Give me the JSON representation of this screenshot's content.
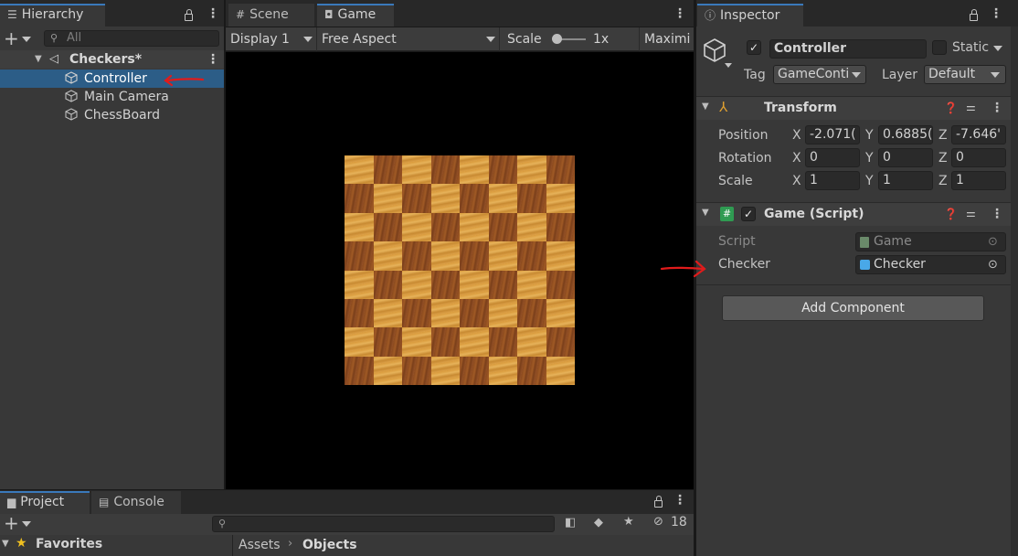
{
  "hierarchy": {
    "tab_label": "Hierarchy",
    "search_placeholder": "All",
    "scene_name": "Checkers*",
    "items": [
      {
        "label": "Controller"
      },
      {
        "label": "Main Camera"
      },
      {
        "label": "ChessBoard"
      }
    ]
  },
  "game_view": {
    "tabs": [
      {
        "label": "Scene",
        "icon": "grid-icon"
      },
      {
        "label": "Game",
        "icon": "gamepad-icon"
      }
    ],
    "display": "Display 1",
    "aspect": "Free Aspect",
    "scale_label": "Scale",
    "scale_value": "1x",
    "maximize_label": "Maximi",
    "board": {
      "rows": 8,
      "cols": 8
    }
  },
  "inspector": {
    "tab_label": "Inspector",
    "object_name": "Controller",
    "static_label": "Static",
    "tag_label": "Tag",
    "tag_value": "GameConti",
    "layer_label": "Layer",
    "layer_value": "Default",
    "transform": {
      "title": "Transform",
      "position_label": "Position",
      "rotation_label": "Rotation",
      "scale_label": "Scale",
      "axis_x": "X",
      "axis_y": "Y",
      "axis_z": "Z",
      "position": {
        "x": "-2.071(",
        "y": "0.6885(",
        "z": "-7.646'"
      },
      "rotation": {
        "x": "0",
        "y": "0",
        "z": "0"
      },
      "scale": {
        "x": "1",
        "y": "1",
        "z": "1"
      }
    },
    "script_component": {
      "title": "Game (Script)",
      "script_label": "Script",
      "script_value": "Game",
      "checker_label": "Checker",
      "checker_value": "Checker"
    },
    "add_component": "Add Component"
  },
  "bottom": {
    "tabs": [
      {
        "label": "Project"
      },
      {
        "label": "Console"
      }
    ],
    "favorites_label": "Favorites",
    "breadcrumb": [
      "Assets",
      "Objects"
    ],
    "hidden_count": "18"
  },
  "colors": {
    "accent": "#3a79bb",
    "selection": "#2c5d87",
    "annotation": "#e01b1b"
  }
}
